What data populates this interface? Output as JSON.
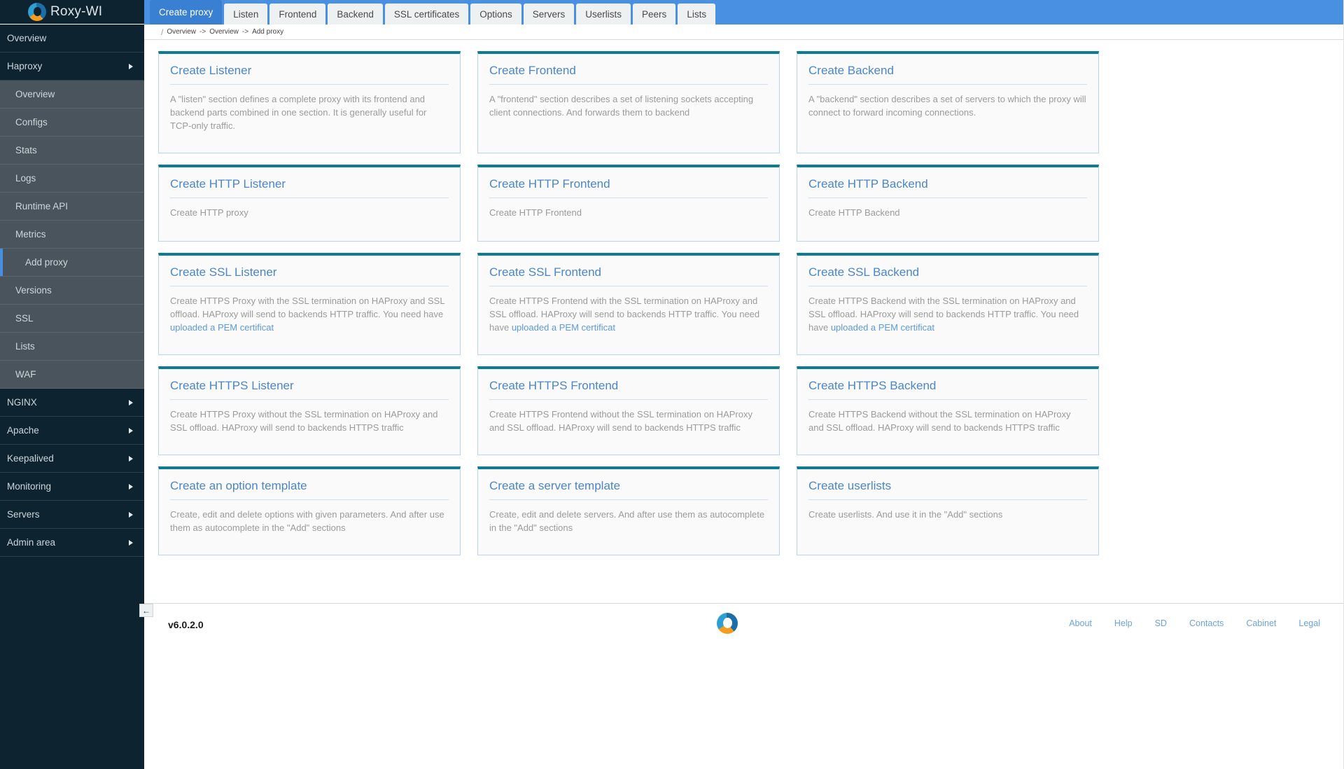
{
  "brand": {
    "name": "Roxy-WI",
    "logo_icon": "roxy-wi-logo-icon"
  },
  "sidebar": {
    "items": [
      {
        "label": "Overview",
        "type": "top",
        "has_arrow": false,
        "active": false
      },
      {
        "label": "Haproxy",
        "type": "top",
        "has_arrow": true,
        "active": false
      },
      {
        "label": "Overview",
        "type": "sub",
        "has_arrow": false,
        "active": false
      },
      {
        "label": "Configs",
        "type": "sub",
        "has_arrow": false,
        "active": false
      },
      {
        "label": "Stats",
        "type": "sub",
        "has_arrow": false,
        "active": false
      },
      {
        "label": "Logs",
        "type": "sub",
        "has_arrow": false,
        "active": false
      },
      {
        "label": "Runtime API",
        "type": "sub",
        "has_arrow": false,
        "active": false
      },
      {
        "label": "Metrics",
        "type": "sub",
        "has_arrow": false,
        "active": false
      },
      {
        "label": "Add proxy",
        "type": "sub",
        "has_arrow": false,
        "active": true
      },
      {
        "label": "Versions",
        "type": "sub",
        "has_arrow": false,
        "active": false
      },
      {
        "label": "SSL",
        "type": "sub",
        "has_arrow": false,
        "active": false
      },
      {
        "label": "Lists",
        "type": "sub",
        "has_arrow": false,
        "active": false
      },
      {
        "label": "WAF",
        "type": "sub",
        "has_arrow": false,
        "active": false
      },
      {
        "label": "NGINX",
        "type": "top",
        "has_arrow": true,
        "active": false
      },
      {
        "label": "Apache",
        "type": "top",
        "has_arrow": true,
        "active": false
      },
      {
        "label": "Keepalived",
        "type": "top",
        "has_arrow": true,
        "active": false
      },
      {
        "label": "Monitoring",
        "type": "top",
        "has_arrow": true,
        "active": false
      },
      {
        "label": "Servers",
        "type": "top",
        "has_arrow": true,
        "active": false
      },
      {
        "label": "Admin area",
        "type": "top",
        "has_arrow": true,
        "active": false
      }
    ]
  },
  "tabs": [
    {
      "label": "Create proxy",
      "active": true
    },
    {
      "label": "Listen",
      "active": false
    },
    {
      "label": "Frontend",
      "active": false
    },
    {
      "label": "Backend",
      "active": false
    },
    {
      "label": "SSL certificates",
      "active": false
    },
    {
      "label": "Options",
      "active": false
    },
    {
      "label": "Servers",
      "active": false
    },
    {
      "label": "Userlists",
      "active": false
    },
    {
      "label": "Peers",
      "active": false
    },
    {
      "label": "Lists",
      "active": false
    }
  ],
  "breadcrumb": {
    "slash": "/",
    "parts": [
      "Overview",
      "Overview",
      "Add proxy"
    ],
    "separator": "->"
  },
  "cards": [
    {
      "title": "Create Listener",
      "body": "A \"listen\" section defines a complete proxy with its frontend and backend parts combined in one section. It is generally useful for TCP-only traffic.",
      "link": null
    },
    {
      "title": "Create Frontend",
      "body": "A \"frontend\" section describes a set of listening sockets accepting client connections. And forwards them to backend",
      "link": null
    },
    {
      "title": "Create Backend",
      "body": "A \"backend\" section describes a set of servers to which the proxy will connect to forward incoming connections.",
      "link": null
    },
    {
      "title": "Create HTTP Listener",
      "body": "Create HTTP proxy",
      "link": null
    },
    {
      "title": "Create HTTP Frontend",
      "body": "Create HTTP Frontend",
      "link": null
    },
    {
      "title": "Create HTTP Backend",
      "body": "Create HTTP Backend",
      "link": null
    },
    {
      "title": "Create SSL Listener",
      "body": "Create HTTPS Proxy with the SSL termination on HAProxy and SSL offload. HAProxy will send to backends HTTP traffic. You need have ",
      "link": "uploaded a PEM certificat"
    },
    {
      "title": "Create SSL Frontend",
      "body": "Create HTTPS Frontend with the SSL termination on HAProxy and SSL offload. HAProxy will send to backends HTTP traffic. You need have ",
      "link": "uploaded a PEM certificat"
    },
    {
      "title": "Create SSL Backend",
      "body": "Create HTTPS Backend with the SSL termination on HAProxy and SSL offload. HAProxy will send to backends HTTP traffic. You need have ",
      "link": "uploaded a PEM certificat"
    },
    {
      "title": "Create HTTPS Listener",
      "body": "Create HTTPS Proxy without the SSL termination on HAProxy and SSL offload. HAProxy will send to backends HTTPS traffic",
      "link": null
    },
    {
      "title": "Create HTTPS Frontend",
      "body": "Create HTTPS Frontend without the SSL termination on HAProxy and SSL offload. HAProxy will send to backends HTTPS traffic",
      "link": null
    },
    {
      "title": "Create HTTPS Backend",
      "body": "Create HTTPS Backend without the SSL termination on HAProxy and SSL offload. HAProxy will send to backends HTTPS traffic",
      "link": null
    },
    {
      "title": "Create an option template",
      "body": "Create, edit and delete options with given parameters. And after use them as autocomplete in the \"Add\" sections",
      "link": null
    },
    {
      "title": "Create a server template",
      "body": "Create, edit and delete servers. And after use them as autocomplete in the \"Add\" sections",
      "link": null
    },
    {
      "title": "Create userlists",
      "body": "Create userlists. And use it in the \"Add\" sections",
      "link": null
    }
  ],
  "footer": {
    "version": "v6.0.2.0",
    "collapse_icon": "←",
    "logo_icon": "roxy-wi-logo-icon",
    "links": [
      "About",
      "Help",
      "SD",
      "Contacts",
      "Cabinet",
      "Legal"
    ]
  },
  "colors": {
    "sidebar_bg": "#0d2430",
    "sidebar_sub_bg": "#4a545c",
    "tabbar_blue": "#4a90e2",
    "active_tab_blue": "#3a80d2",
    "card_top_teal": "#0b7c92",
    "card_border": "#b9d4ef",
    "title_blue": "#4a86c8",
    "link_blue": "#6ba2e0"
  }
}
